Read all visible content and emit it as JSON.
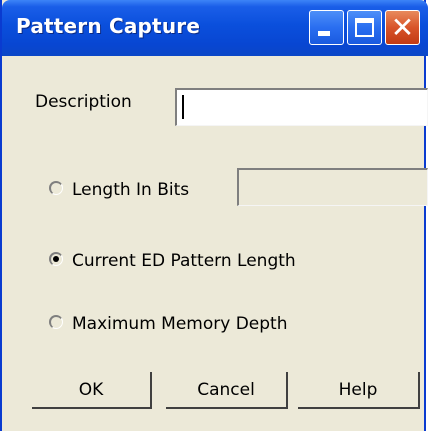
{
  "window": {
    "title": "Pattern Capture",
    "controls": {
      "minimize": "minimize-icon",
      "maximize": "maximize-icon",
      "close": "close-icon"
    },
    "accent_color": "#0a4fdc",
    "close_color": "#d8542a"
  },
  "form": {
    "description_label": "Description",
    "description_value": "",
    "options": [
      {
        "label": "Length In Bits",
        "selected": false
      },
      {
        "label": "Current ED Pattern Length",
        "selected": true
      },
      {
        "label": "Maximum Memory Depth",
        "selected": false
      }
    ],
    "length_in_bits_value": ""
  },
  "buttons": {
    "ok": "OK",
    "cancel": "Cancel",
    "help": "Help"
  }
}
